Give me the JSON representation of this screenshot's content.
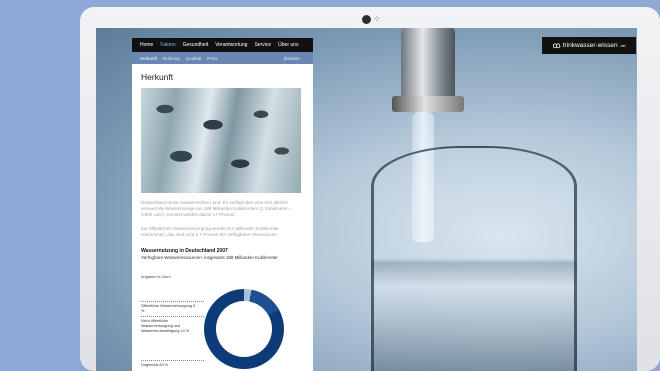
{
  "site": {
    "logo_text": "trinkwasser-wissen",
    "logo_suffix": ".net"
  },
  "topnav": [
    "Home",
    "Fakten",
    "Gesundheit",
    "Verantwortung",
    "Service",
    "Über uns"
  ],
  "subnav": [
    "Herkunft",
    "Nutzung",
    "Qualität",
    "Preis"
  ],
  "print_label": "drucken",
  "page": {
    "title": "Herkunft",
    "para1": "Deutschland ist ein wasserreiches Land. Es verfügt über eine sich jährlich erneuernde Wassermenge von 188 Milliarden Kubikmetern (1 Kubikmeter = 1.000 Liter). Genutzt werden davon 17 Prozent.",
    "para2": "Zur öffentlichen Wasserversorgung werden 5,1 Milliarden Kubikmeter entnommen, das sind rund 2,7 Prozent der verfügbaren Ressourcen.",
    "section_title": "Wassernutzung in Deutschland 2007",
    "section_sub": "Verfügbare Wasserressourcen: insgesamt 188 Milliarden Kubikmeter",
    "unit_note": "Angaben in Litern"
  },
  "chart_data": {
    "type": "pie",
    "categories": [
      "Öffentliche Wasserversorgung",
      "Nicht öffentliche Wasserversorgung und Wasserein-beseitigung",
      "Ungenutzt"
    ],
    "values": [
      3,
      14,
      83
    ],
    "labels": [
      "Öffentliche Wasserversorgung 3 %",
      "Nicht öffentliche Wasserversorgung und Wasserein-beseitigung 14 %",
      "Ungenutzt 83 %"
    ],
    "colors": [
      "#a7c0dc",
      "#1f4f8f",
      "#0d3b79"
    ]
  }
}
